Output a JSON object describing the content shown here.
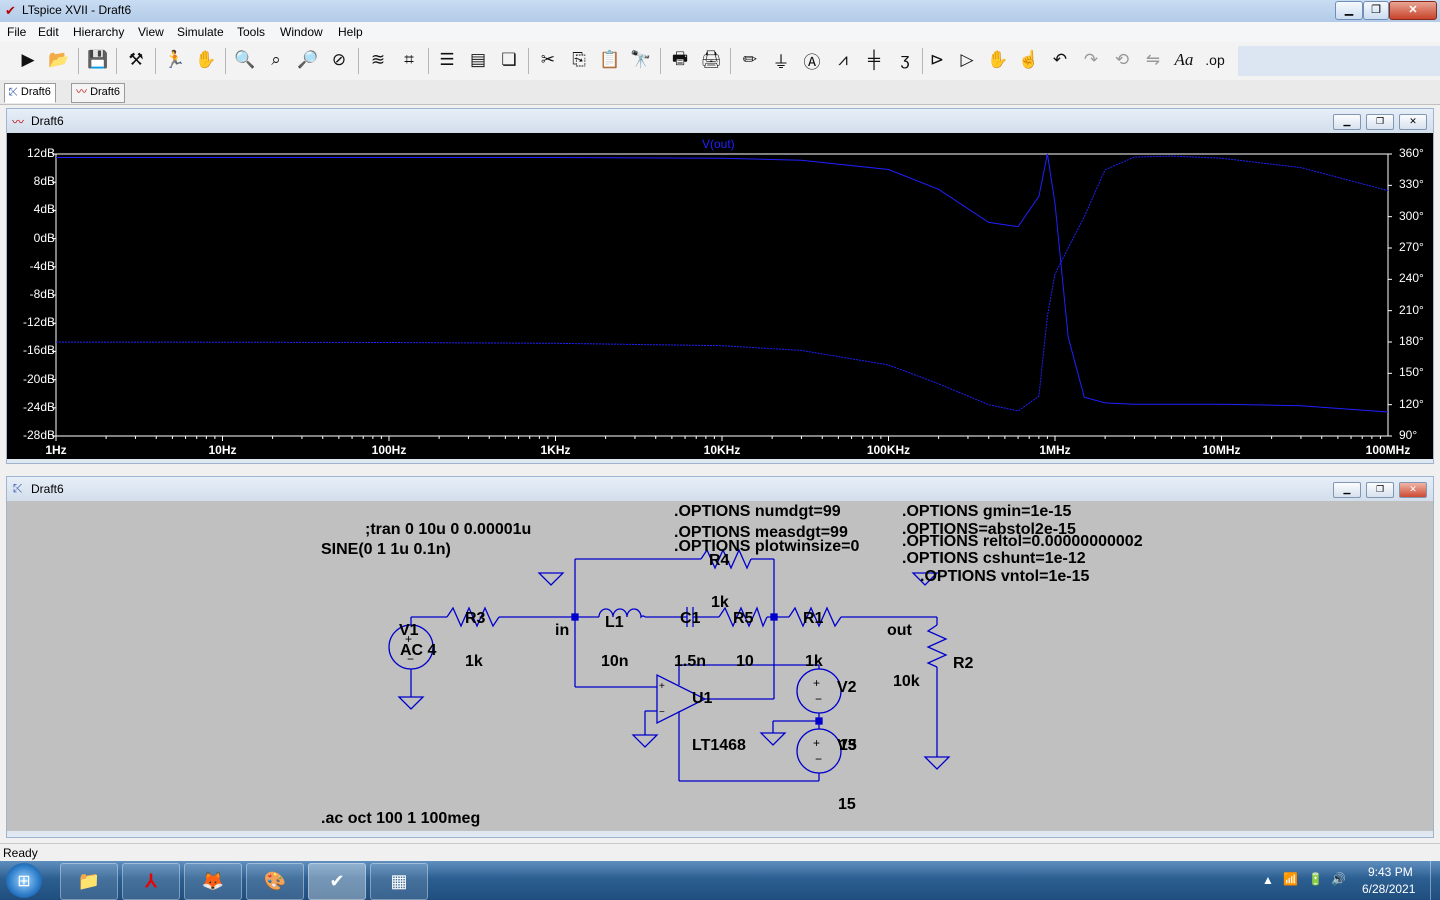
{
  "window": {
    "title": "LTspice XVII - Draft6"
  },
  "menu": [
    "File",
    "Edit",
    "Hierarchy",
    "View",
    "Simulate",
    "Tools",
    "Window",
    "Help"
  ],
  "toolbar_icons": [
    "run-icon",
    "open-icon",
    "save-icon",
    "control-panel-icon",
    "halt-icon",
    "pan-icon",
    "zoom-in-icon",
    "zoom-area-icon",
    "zoom-out-icon",
    "zoom-cancel-icon",
    "autorange-icon",
    "mark-icon",
    "tile-horizontal-icon",
    "tile-vertical-icon",
    "cascade-icon",
    "cut-icon",
    "copy-icon",
    "paste-icon",
    "find-icon",
    "print-icon",
    "print-preview-icon",
    "draw-wire-icon",
    "ground-icon",
    "label-net-icon",
    "resistor-icon",
    "capacitor-icon",
    "inductor-icon",
    "diode-icon",
    "component-icon",
    "move-icon",
    "drag-icon",
    "undo-icon",
    "redo-icon",
    "rotate-icon",
    "mirror-icon",
    "text-icon",
    "spice-directive-icon"
  ],
  "tabs": [
    {
      "label": "Draft6",
      "icon": "schematic-icon",
      "active": true
    },
    {
      "label": "Draft6",
      "icon": "waveform-icon",
      "active": false
    }
  ],
  "plot_window": {
    "title": "Draft6",
    "trace_label": "V(out)",
    "trace_color": "#2020ff"
  },
  "chart_data": {
    "type": "line",
    "title": "",
    "series": [
      {
        "name": "V(out)",
        "axis": "magnitude",
        "x": [
          1,
          10,
          100,
          1000,
          10000,
          30000,
          100000,
          200000,
          400000,
          600000,
          800000,
          900000,
          1000000,
          1200000,
          1500000,
          2000000,
          3000000,
          5000000,
          10000000,
          30000000,
          100000000
        ],
        "y": [
          11.5,
          11.5,
          11.5,
          11.5,
          11.4,
          11.1,
          9.8,
          7.0,
          2.3,
          1.7,
          6.0,
          12.0,
          5.0,
          -14.0,
          -22.5,
          -23.3,
          -23.5,
          -23.5,
          -23.5,
          -23.7,
          -24.6
        ]
      },
      {
        "name": "V(out) phase",
        "axis": "phase",
        "x": [
          1,
          10,
          100,
          1000,
          10000,
          30000,
          100000,
          200000,
          400000,
          600000,
          800000,
          900000,
          1000000,
          1200000,
          1500000,
          2000000,
          3000000,
          5000000,
          10000000,
          30000000,
          100000000
        ],
        "y": [
          179.9,
          179.8,
          179.5,
          178.8,
          176.5,
          172.0,
          158.0,
          140.0,
          120.0,
          114.0,
          128.0,
          205.0,
          245.0,
          270.0,
          300.0,
          345.0,
          357.0,
          358.0,
          356.0,
          347.0,
          325.0
        ]
      }
    ],
    "x_axis": {
      "scale": "log",
      "range": [
        1,
        100000000
      ],
      "ticks": [
        "1Hz",
        "10Hz",
        "100Hz",
        "1KHz",
        "10KHz",
        "100KHz",
        "1MHz",
        "10MHz",
        "100MHz"
      ]
    },
    "y_axis": {
      "range": [
        -28,
        12
      ],
      "ticks": [
        "12dB",
        "8dB",
        "4dB",
        "0dB",
        "-4dB",
        "-8dB",
        "-12dB",
        "-16dB",
        "-20dB",
        "-24dB",
        "-28dB"
      ]
    },
    "y2_axis": {
      "range": [
        90,
        360
      ],
      "ticks": [
        "360°",
        "330°",
        "300°",
        "270°",
        "240°",
        "210°",
        "180°",
        "150°",
        "120°",
        "90°"
      ]
    },
    "grid": false,
    "legend": "top-center"
  },
  "schematic_window": {
    "title": "Draft6",
    "texts": {
      "tran": ";tran 0 10u 0 0.00001u",
      "sine": "SINE(0 1 1u 0.1n)",
      "opt_numdgt": ".OPTIONS numdgt=99",
      "opt_measdgt": ".OPTIONS measdgt=99",
      "opt_plotwinsize": ".OPTIONS plotwinsize=0",
      "opt_gmin": ".OPTIONS gmin=1e-15",
      "opt_abstol": ".OPTIONS=abstol2e-15",
      "opt_reltol": ".OPTIONS reltol=0.00000000002",
      "opt_cshunt": ".OPTIONS cshunt=1e-12",
      "opt_vntol": ".OPTIONS vntol=1e-15",
      "ac": ".ac oct 100 1 100meg"
    },
    "components": {
      "v1_name": "V1",
      "v1_value": "AC 4",
      "r3_name": "R3",
      "r3_value": "1k",
      "net_in": "in",
      "l1_name": "L1",
      "l1_value": "10n",
      "c1_name": "C1",
      "c1_value": "1.5n",
      "r5_name": "R5",
      "r5_value": "10",
      "r4_name": "R4",
      "r4_value": "1k",
      "r1_name": "R1",
      "r1_value": "1k",
      "net_out": "out",
      "r2_name": "R2",
      "r2_value": "10k",
      "u1_name": "U1",
      "u1_part": "LT1468",
      "v2_name": "V2",
      "v3_name": "V3",
      "v3_value": "15",
      "v2_value": "15"
    }
  },
  "status": {
    "text": "Ready"
  },
  "taskbar": {
    "apps": [
      "start-orb",
      "file-explorer-icon",
      "pdf-reader-icon",
      "firefox-icon",
      "paint-icon",
      "ltspice-icon",
      "calculator-icon"
    ],
    "time": "9:43 PM",
    "date": "6/28/2021"
  }
}
